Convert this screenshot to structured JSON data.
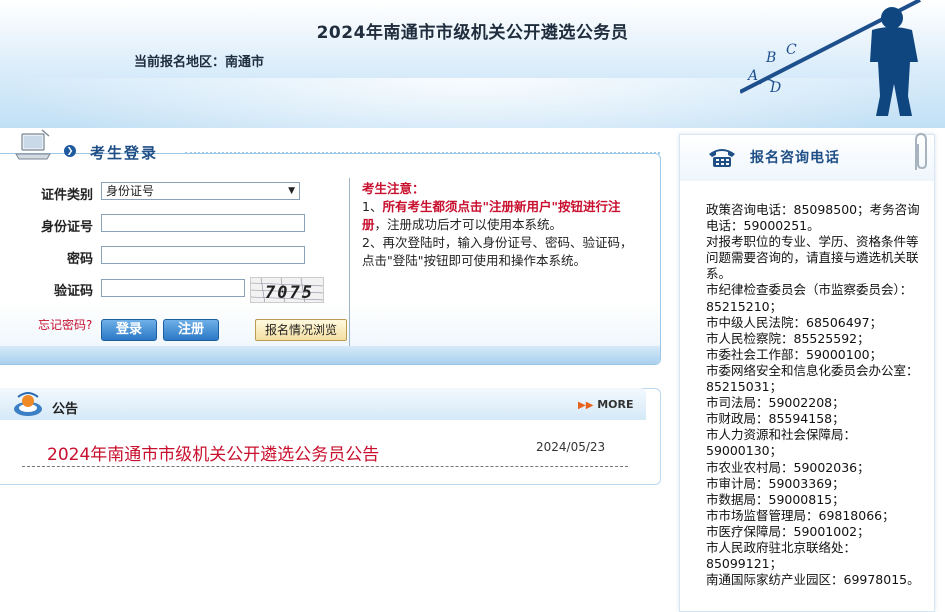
{
  "header": {
    "title": "2024年南通市市级机关公开遴选公务员",
    "region_label": "当前报名地区：",
    "region_value": "南通市",
    "art_letters": [
      "A",
      "B",
      "C",
      "D"
    ]
  },
  "login": {
    "title": "考生登录",
    "id_type_label": "证件类别",
    "id_type_selected": "身份证号",
    "id_number_label": "身份证号",
    "id_number_value": "",
    "password_label": "密码",
    "password_value": "",
    "captcha_label": "验证码",
    "captcha_value": "",
    "captcha_text": "7075",
    "forgot_label": "忘记密码?",
    "login_button": "登录",
    "register_button": "注册",
    "browse_button": "报名情况浏览"
  },
  "notice": {
    "heading": "考生注意：",
    "line1_num": "1、",
    "line1_red": "所有考生都须点击\"注册新用户\"按钮进行注册",
    "line1_rest": "，注册成功后才可以使用本系统。",
    "line2": "2、再次登陆时，输入身份证号、密码、验证码，点击\"登陆\"按钮即可使用和操作本系统。"
  },
  "announcements": {
    "title": "公告",
    "more_label": "MORE",
    "items": [
      {
        "title": "2024年南通市市级机关公开遴选公务员公告",
        "date": "2024/05/23"
      }
    ]
  },
  "phones": {
    "title": "报名咨询电话",
    "entries": [
      "政策咨询电话：85098500；考务咨询电话：59000251。",
      "对报考职位的专业、学历、资格条件等问题需要咨询的，请直接与遴选机关联系。",
      "市纪律检查委员会（市监察委员会）：85215210；",
      "市中级人民法院：68506497；",
      "市人民检察院：85525592；",
      "市委社会工作部：59000100；",
      "市委网络安全和信息化委员会办公室：85215031；",
      "市司法局：59002208；",
      "市财政局：85594158；",
      "市人力资源和社会保障局：59000130；",
      "市农业农村局：59002036；",
      "市审计局：59003369；",
      "市数据局：59000815；",
      "市市场监督管理局：69818066；",
      "市医疗保障局：59001002；",
      "市人民政府驻北京联络处：85099121；",
      "南通国际家纺产业园区：69978015。"
    ]
  },
  "colors": {
    "accent_blue": "#1f4f86",
    "alert_red": "#c8102e",
    "button_blue": "#2b78c5"
  }
}
